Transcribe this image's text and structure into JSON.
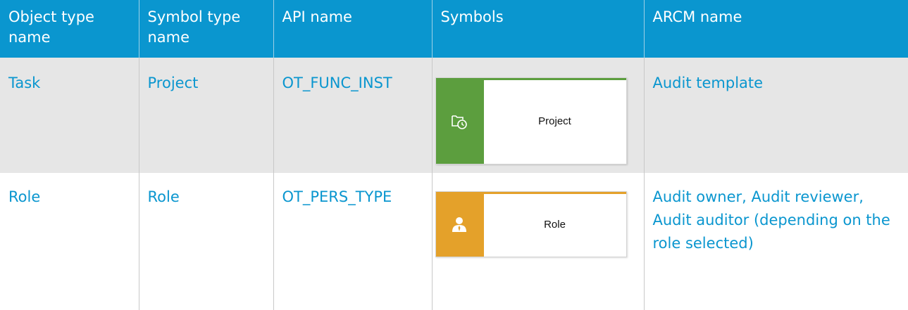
{
  "colors": {
    "header_bg": "#0a96cf",
    "header_text": "#ffffff",
    "link_text": "#0a96cf",
    "row_alt_bg": "#e6e6e6",
    "project_band": "#5c9e3e",
    "role_band": "#e4a12a"
  },
  "table": {
    "headers": [
      "Object type name",
      "Symbol type name",
      "API name",
      "Symbols",
      "ARCM name"
    ],
    "rows": [
      {
        "object_type": "Task",
        "symbol_type": "Project",
        "api_name": "OT_FUNC_INST",
        "symbol": {
          "label": "Project",
          "icon": "project-folder-clock-icon"
        },
        "arcm_name": "Audit template"
      },
      {
        "object_type": "Role",
        "symbol_type": "Role",
        "api_name": "OT_PERS_TYPE",
        "symbol": {
          "label": "Role",
          "icon": "person-icon"
        },
        "arcm_name": "Audit owner, Audit reviewer, Audit auditor (depending on the role selected)"
      }
    ]
  }
}
